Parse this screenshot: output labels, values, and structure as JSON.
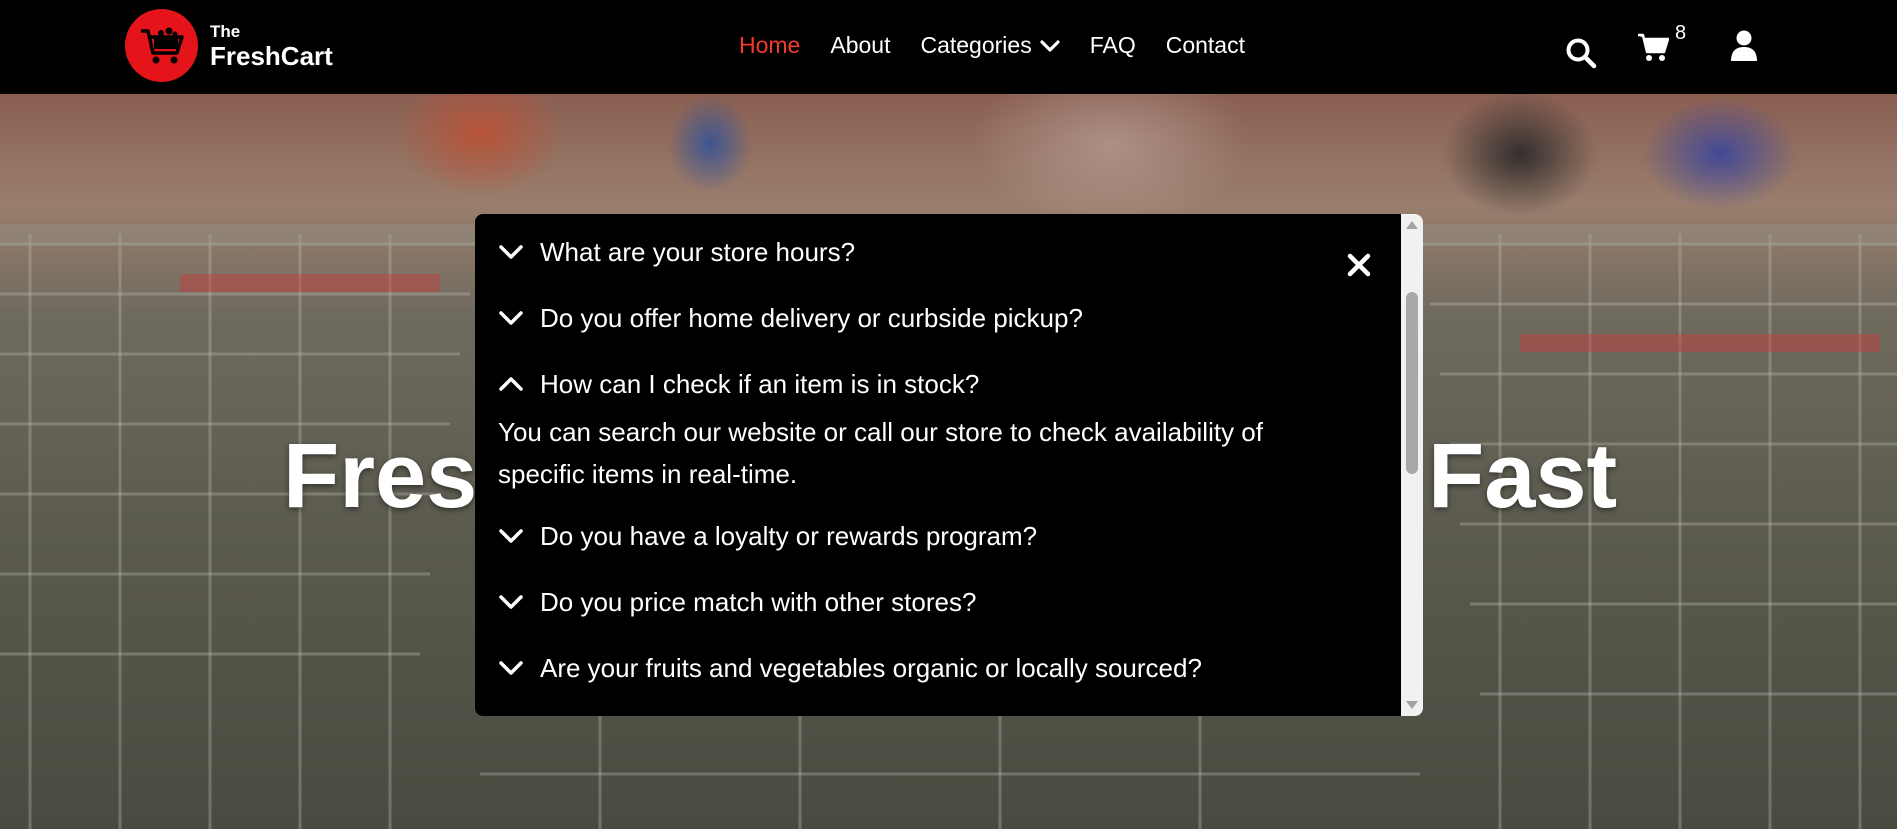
{
  "brand": {
    "small": "The",
    "big": "FreshCart",
    "color": "#e5141b"
  },
  "nav": {
    "items": [
      {
        "label": "Home",
        "active": true
      },
      {
        "label": "About"
      },
      {
        "label": "Categories",
        "has_dropdown": true
      },
      {
        "label": "FAQ"
      },
      {
        "label": "Contact"
      }
    ],
    "active_color": "#f23a2e"
  },
  "icons": {
    "search": "search-icon",
    "cart": "cart-icon",
    "user": "user-icon"
  },
  "cart": {
    "count": "8"
  },
  "hero": {
    "headline_left": "Fres",
    "headline_right": "Fast"
  },
  "faq": {
    "items": [
      {
        "question": "What are your store hours?",
        "expanded": false
      },
      {
        "question": "Do you offer home delivery or curbside pickup?",
        "expanded": false
      },
      {
        "question": "How can I check if an item is in stock?",
        "expanded": true,
        "answer": "You can search our website or call our store to check availability of specific items in real-time."
      },
      {
        "question": "Do you have a loyalty or rewards program?",
        "expanded": false
      },
      {
        "question": "Do you price match with other stores?",
        "expanded": false
      },
      {
        "question": "Are your fruits and vegetables organic or locally sourced?",
        "expanded": false
      }
    ]
  }
}
